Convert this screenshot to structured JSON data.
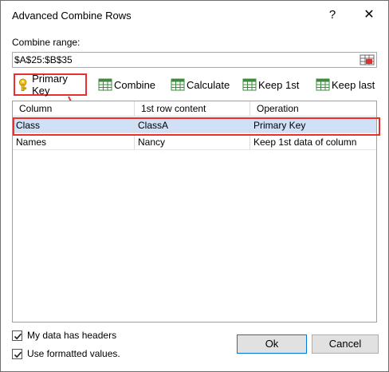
{
  "window": {
    "title": "Advanced Combine Rows",
    "help_symbol": "?",
    "close_symbol": "✕"
  },
  "range": {
    "label": "Combine range:",
    "value": "$A$25:$B$35",
    "picker_icon": "range-select-icon"
  },
  "toolbar": {
    "primary_key": "Primary Key",
    "combine": "Combine",
    "calculate": "Calculate",
    "keep_first": "Keep 1st",
    "keep_last": "Keep last"
  },
  "grid": {
    "headers": [
      "Column",
      "1st row content",
      "Operation"
    ],
    "rows": [
      {
        "column": "Class",
        "content": "ClassA",
        "operation": "Primary Key",
        "selected": true
      },
      {
        "column": "Names",
        "content": "Nancy",
        "operation": "Keep 1st data of column",
        "selected": false
      }
    ]
  },
  "options": {
    "headers_label": "My data has headers",
    "headers_checked": true,
    "formatted_label": "Use formatted values.",
    "formatted_checked": true
  },
  "buttons": {
    "ok": "Ok",
    "cancel": "Cancel"
  },
  "colors": {
    "highlight": "#e8312f",
    "selected_row": "#cfe0f7",
    "ok_border": "#0078d7"
  }
}
